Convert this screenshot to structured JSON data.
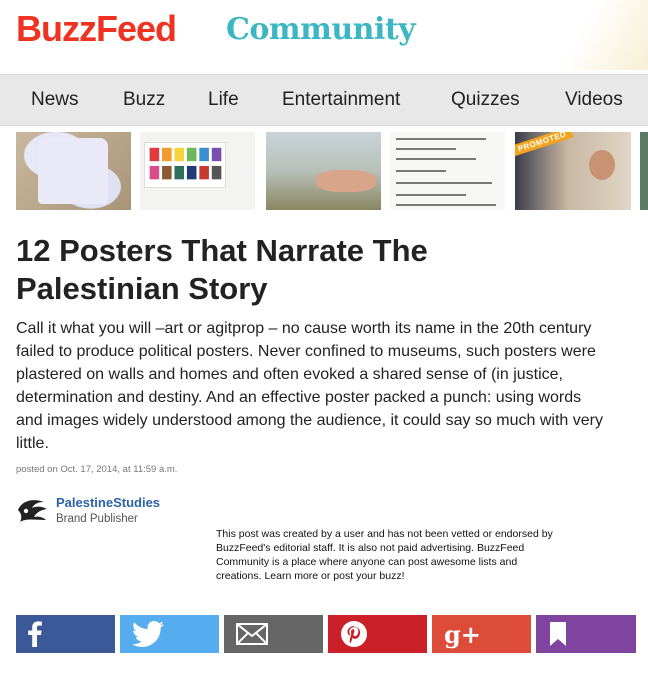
{
  "brand": {
    "logo_primary": "BuzzFeed",
    "logo_secondary": "Community",
    "primary_color": "#ee3322",
    "secondary_color": "#3bb6c2"
  },
  "nav": {
    "items": [
      "News",
      "Buzz",
      "Life",
      "Entertainment",
      "Quizzes",
      "Videos"
    ]
  },
  "thumbnails": {
    "promoted_label": "PROMOTED"
  },
  "article": {
    "title_line1": "12 Posters That Narrate The",
    "title_line2": "Palestinian Story",
    "intro_lines": [
      "Call it what you will –art or agitprop – no cause worth its name in the 20th century",
      "failed to produce political posters. Never confined to museums, such posters were",
      "plastered on walls and homes and often evoked a shared sense of (in justice,",
      "determination and destiny. And an effective poster packed a punch: using words",
      "and images widely understood among the audience, it could say so much with very",
      "little."
    ],
    "posted": "posted on Oct. 17, 2014, at 11:59 a.m."
  },
  "author": {
    "name": "PalestineStudies",
    "role": "Brand Publisher"
  },
  "disclaimer": {
    "lines": [
      "This post was created by a user and has not been vetted or endorsed by",
      "BuzzFeed's editorial staff. It is also not paid advertising. BuzzFeed",
      "Community is a place where anyone can post awesome lists and",
      "creations. Learn more or post your buzz!"
    ]
  },
  "share": {
    "buttons": [
      {
        "icon": "facebook-icon",
        "color": "#3b5998"
      },
      {
        "icon": "twitter-icon",
        "color": "#55acee"
      },
      {
        "icon": "email-icon",
        "color": "#666666"
      },
      {
        "icon": "pinterest-icon",
        "color": "#cb2027"
      },
      {
        "icon": "google-plus-icon",
        "color": "#dd4b39",
        "glyph": "g+"
      },
      {
        "icon": "bookmark-icon",
        "color": "#7f43a0"
      }
    ]
  }
}
